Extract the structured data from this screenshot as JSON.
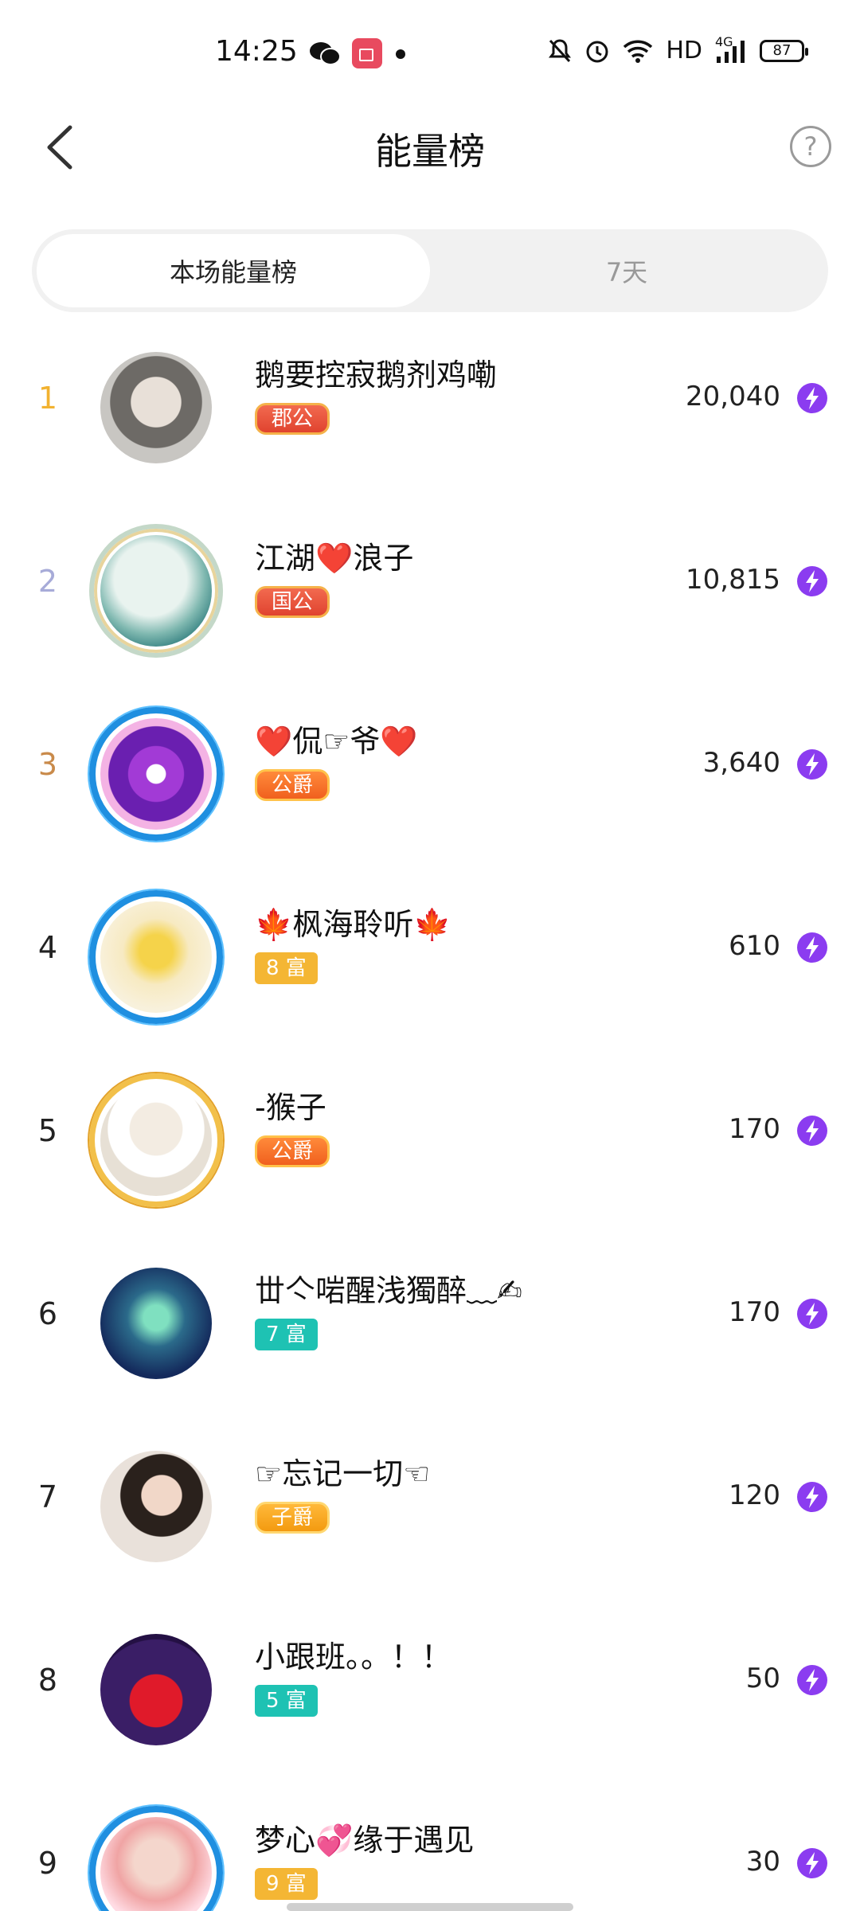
{
  "status_bar": {
    "time": "14:25",
    "network": "HD",
    "signal": "4G",
    "battery": "87",
    "icons": [
      "wechat-icon",
      "screen-record-icon",
      "mute-bell-icon",
      "alarm-icon",
      "wifi-icon",
      "signal-icon",
      "battery-icon"
    ]
  },
  "header": {
    "title": "能量榜",
    "back_icon": "chevron-left-icon",
    "help_label": "?"
  },
  "tabs": [
    {
      "label": "本场能量榜",
      "active": true
    },
    {
      "label": "7天",
      "active": false
    }
  ],
  "colors": {
    "rank1": "#f2b230",
    "rank2": "#a7abd8",
    "rank3": "#c98a4a",
    "energy": "#8b3cf0",
    "teal": "#1ec2b3",
    "gold": "#f4b634"
  },
  "ranking": [
    {
      "rank": "1",
      "name": "鹅要控寂鹅剂鸡嘞",
      "badge": "郡公",
      "score": "20,040"
    },
    {
      "rank": "2",
      "name": "江湖❤️浪子",
      "badge": "国公",
      "score": "10,815"
    },
    {
      "rank": "3",
      "name": "❤️侃☞爷❤️",
      "badge": "公爵",
      "score": "3,640"
    },
    {
      "rank": "4",
      "name": "🍁枫海聆听🍁",
      "badge": "8 富",
      "score": "610"
    },
    {
      "rank": "5",
      "name": "-猴子",
      "badge": "公爵",
      "score": "170"
    },
    {
      "rank": "6",
      "name": "丗亽啱醒浅獨醉﹏✍",
      "badge": "7 富",
      "score": "170"
    },
    {
      "rank": "7",
      "name": "☞忘记一切☜",
      "badge": "子爵",
      "score": "120"
    },
    {
      "rank": "8",
      "name": "小跟班。。！！",
      "badge": "5 富",
      "score": "50"
    },
    {
      "rank": "9",
      "name": "梦心💞缘于遇见",
      "badge": "9 富",
      "score": "30"
    }
  ]
}
